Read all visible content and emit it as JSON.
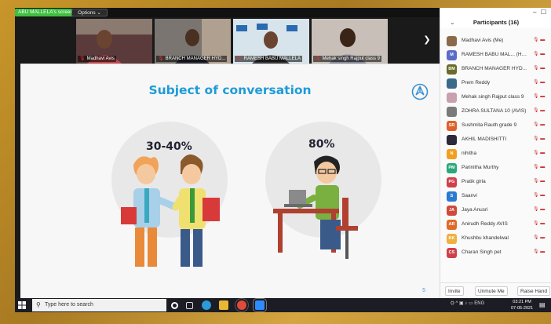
{
  "screen_share": {
    "label": "ABU MALLELA's screen",
    "options_label": "Options  ⌄"
  },
  "video_strip": {
    "tiles": [
      {
        "name": "Madhavi Avis"
      },
      {
        "name": "BRANCH MANAGER HYD..."
      },
      {
        "name": "RAMESH BABU MALLELA"
      },
      {
        "name": "Mehak singh Rajput class 9"
      }
    ],
    "next_icon": "chevron-right"
  },
  "slide": {
    "title": "Subject of conversation",
    "left_percent": "30-40%",
    "right_percent": "80%",
    "page_number": "5"
  },
  "participants": {
    "title": "Participants (16)",
    "collapse_glyph": "⌄",
    "window_min": "–",
    "window_max": "☐",
    "list": [
      {
        "initials": "",
        "name": "Madhavi Avis (Me)",
        "color": "#8a6a4a"
      },
      {
        "initials": "M",
        "name": "RAMESH BABU MAL... (Host)",
        "color": "#5b6bc8"
      },
      {
        "initials": "BM",
        "name": "BRANCH MANAGER HYD...",
        "color": "#6b6b2a"
      },
      {
        "initials": "",
        "name": "Prem Reddy",
        "color": "#3a6a8a"
      },
      {
        "initials": "",
        "name": "Mehak singh Rajput class 9",
        "color": "#c8a0b0"
      },
      {
        "initials": "",
        "name": "ZOHRA SULTANA 10 (AVIS)",
        "color": "#7a7a7a"
      },
      {
        "initials": "SR",
        "name": "Sushmita Rauth grade 9",
        "color": "#e0602a"
      },
      {
        "initials": "",
        "name": "AKHIL MADISHITTI",
        "color": "#2a2a3a"
      },
      {
        "initials": "N",
        "name": "nihitha",
        "color": "#f0a020"
      },
      {
        "initials": "PM",
        "name": "Parinitha Murthy",
        "color": "#2aa87a"
      },
      {
        "initials": "PG",
        "name": "Pratik girla",
        "color": "#d0404a"
      },
      {
        "initials": "S",
        "name": "Saanvi",
        "color": "#2a7ad0"
      },
      {
        "initials": "JA",
        "name": "Jaya Anusri",
        "color": "#d04a3a"
      },
      {
        "initials": "AR",
        "name": "Anirudh Reddy AVIS",
        "color": "#e06a2a"
      },
      {
        "initials": "KK",
        "name": "Khushbu khandelwal",
        "color": "#f0b040"
      },
      {
        "initials": "CS",
        "name": "Charan Singh pet",
        "color": "#d0404a"
      }
    ],
    "footer": {
      "invite": "Invite",
      "unmute_me": "Unmute Me",
      "raise_hand": "Raise Hand"
    }
  },
  "taskbar": {
    "search_placeholder": "Type here to search",
    "tray_text": "ENG",
    "time": "03:21 PM",
    "date": "07-05-2021"
  }
}
